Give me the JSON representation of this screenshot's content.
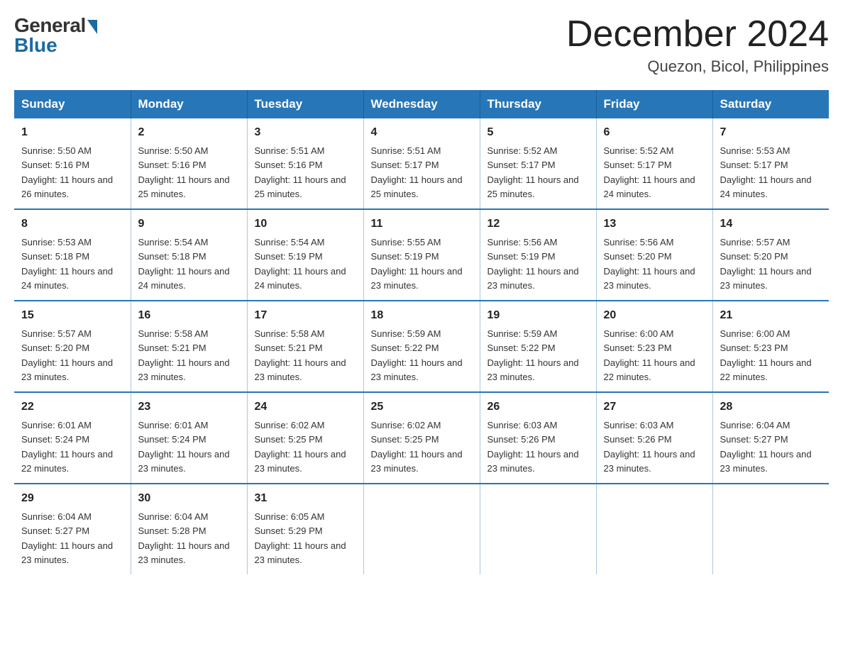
{
  "logo": {
    "general": "General",
    "blue": "Blue"
  },
  "title": "December 2024",
  "subtitle": "Quezon, Bicol, Philippines",
  "days_of_week": [
    "Sunday",
    "Monday",
    "Tuesday",
    "Wednesday",
    "Thursday",
    "Friday",
    "Saturday"
  ],
  "weeks": [
    [
      {
        "day": "1",
        "sunrise": "5:50 AM",
        "sunset": "5:16 PM",
        "daylight": "11 hours and 26 minutes."
      },
      {
        "day": "2",
        "sunrise": "5:50 AM",
        "sunset": "5:16 PM",
        "daylight": "11 hours and 25 minutes."
      },
      {
        "day": "3",
        "sunrise": "5:51 AM",
        "sunset": "5:16 PM",
        "daylight": "11 hours and 25 minutes."
      },
      {
        "day": "4",
        "sunrise": "5:51 AM",
        "sunset": "5:17 PM",
        "daylight": "11 hours and 25 minutes."
      },
      {
        "day": "5",
        "sunrise": "5:52 AM",
        "sunset": "5:17 PM",
        "daylight": "11 hours and 25 minutes."
      },
      {
        "day": "6",
        "sunrise": "5:52 AM",
        "sunset": "5:17 PM",
        "daylight": "11 hours and 24 minutes."
      },
      {
        "day": "7",
        "sunrise": "5:53 AM",
        "sunset": "5:17 PM",
        "daylight": "11 hours and 24 minutes."
      }
    ],
    [
      {
        "day": "8",
        "sunrise": "5:53 AM",
        "sunset": "5:18 PM",
        "daylight": "11 hours and 24 minutes."
      },
      {
        "day": "9",
        "sunrise": "5:54 AM",
        "sunset": "5:18 PM",
        "daylight": "11 hours and 24 minutes."
      },
      {
        "day": "10",
        "sunrise": "5:54 AM",
        "sunset": "5:19 PM",
        "daylight": "11 hours and 24 minutes."
      },
      {
        "day": "11",
        "sunrise": "5:55 AM",
        "sunset": "5:19 PM",
        "daylight": "11 hours and 23 minutes."
      },
      {
        "day": "12",
        "sunrise": "5:56 AM",
        "sunset": "5:19 PM",
        "daylight": "11 hours and 23 minutes."
      },
      {
        "day": "13",
        "sunrise": "5:56 AM",
        "sunset": "5:20 PM",
        "daylight": "11 hours and 23 minutes."
      },
      {
        "day": "14",
        "sunrise": "5:57 AM",
        "sunset": "5:20 PM",
        "daylight": "11 hours and 23 minutes."
      }
    ],
    [
      {
        "day": "15",
        "sunrise": "5:57 AM",
        "sunset": "5:20 PM",
        "daylight": "11 hours and 23 minutes."
      },
      {
        "day": "16",
        "sunrise": "5:58 AM",
        "sunset": "5:21 PM",
        "daylight": "11 hours and 23 minutes."
      },
      {
        "day": "17",
        "sunrise": "5:58 AM",
        "sunset": "5:21 PM",
        "daylight": "11 hours and 23 minutes."
      },
      {
        "day": "18",
        "sunrise": "5:59 AM",
        "sunset": "5:22 PM",
        "daylight": "11 hours and 23 minutes."
      },
      {
        "day": "19",
        "sunrise": "5:59 AM",
        "sunset": "5:22 PM",
        "daylight": "11 hours and 23 minutes."
      },
      {
        "day": "20",
        "sunrise": "6:00 AM",
        "sunset": "5:23 PM",
        "daylight": "11 hours and 22 minutes."
      },
      {
        "day": "21",
        "sunrise": "6:00 AM",
        "sunset": "5:23 PM",
        "daylight": "11 hours and 22 minutes."
      }
    ],
    [
      {
        "day": "22",
        "sunrise": "6:01 AM",
        "sunset": "5:24 PM",
        "daylight": "11 hours and 22 minutes."
      },
      {
        "day": "23",
        "sunrise": "6:01 AM",
        "sunset": "5:24 PM",
        "daylight": "11 hours and 23 minutes."
      },
      {
        "day": "24",
        "sunrise": "6:02 AM",
        "sunset": "5:25 PM",
        "daylight": "11 hours and 23 minutes."
      },
      {
        "day": "25",
        "sunrise": "6:02 AM",
        "sunset": "5:25 PM",
        "daylight": "11 hours and 23 minutes."
      },
      {
        "day": "26",
        "sunrise": "6:03 AM",
        "sunset": "5:26 PM",
        "daylight": "11 hours and 23 minutes."
      },
      {
        "day": "27",
        "sunrise": "6:03 AM",
        "sunset": "5:26 PM",
        "daylight": "11 hours and 23 minutes."
      },
      {
        "day": "28",
        "sunrise": "6:04 AM",
        "sunset": "5:27 PM",
        "daylight": "11 hours and 23 minutes."
      }
    ],
    [
      {
        "day": "29",
        "sunrise": "6:04 AM",
        "sunset": "5:27 PM",
        "daylight": "11 hours and 23 minutes."
      },
      {
        "day": "30",
        "sunrise": "6:04 AM",
        "sunset": "5:28 PM",
        "daylight": "11 hours and 23 minutes."
      },
      {
        "day": "31",
        "sunrise": "6:05 AM",
        "sunset": "5:29 PM",
        "daylight": "11 hours and 23 minutes."
      },
      null,
      null,
      null,
      null
    ]
  ],
  "labels": {
    "sunrise": "Sunrise: ",
    "sunset": "Sunset: ",
    "daylight": "Daylight: "
  }
}
